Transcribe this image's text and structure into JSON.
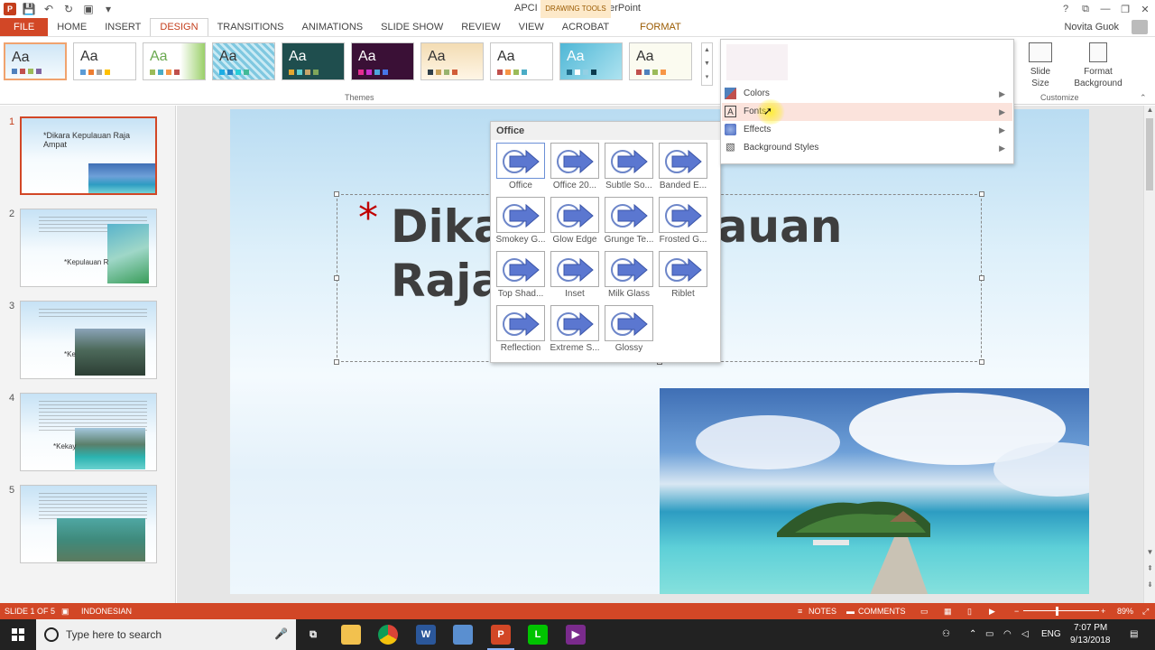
{
  "window": {
    "title": "APCI Raw.pptx - PowerPoint",
    "contextual_tab_group": "DRAWING TOOLS",
    "controls": [
      "?",
      "⧉",
      "—",
      "❐",
      "✕"
    ]
  },
  "quick_access": {
    "icons": [
      "save-icon",
      "undo-icon",
      "redo-icon",
      "start-from-beginning-icon"
    ]
  },
  "tabs": [
    {
      "label": "FILE"
    },
    {
      "label": "HOME"
    },
    {
      "label": "INSERT"
    },
    {
      "label": "DESIGN"
    },
    {
      "label": "TRANSITIONS"
    },
    {
      "label": "ANIMATIONS"
    },
    {
      "label": "SLIDE SHOW"
    },
    {
      "label": "REVIEW"
    },
    {
      "label": "VIEW"
    },
    {
      "label": "ACROBAT"
    },
    {
      "label": "FORMAT"
    }
  ],
  "user": {
    "name": "Novita Guok"
  },
  "ribbon": {
    "themes_group_label": "Themes",
    "customize_group_label": "Customize",
    "theme_sample_text": "Aa",
    "slide_size": {
      "line1": "Slide",
      "line2": "Size"
    },
    "format_background": {
      "line1": "Format",
      "line2": "Background"
    }
  },
  "variants_menu": {
    "items": [
      {
        "label": "Colors",
        "icon": "colors-icon"
      },
      {
        "label": "Fonts",
        "icon": "fonts-icon"
      },
      {
        "label": "Effects",
        "icon": "effects-icon"
      },
      {
        "label": "Background Styles",
        "icon": "background-styles-icon"
      }
    ],
    "highlighted": "Fonts"
  },
  "effects_gallery": {
    "header": "Office",
    "items": [
      {
        "label": "Office"
      },
      {
        "label": "Office 20..."
      },
      {
        "label": "Subtle So..."
      },
      {
        "label": "Banded E..."
      },
      {
        "label": "Smokey G..."
      },
      {
        "label": "Glow Edge"
      },
      {
        "label": "Grunge Te..."
      },
      {
        "label": "Frosted G..."
      },
      {
        "label": "Top Shad..."
      },
      {
        "label": "Inset"
      },
      {
        "label": "Milk Glass"
      },
      {
        "label": "Riblet"
      },
      {
        "label": "Reflection"
      },
      {
        "label": "Extreme S..."
      },
      {
        "label": "Glossy"
      }
    ]
  },
  "slides": [
    {
      "number": "1",
      "title": "*Dikara Kepulauan Raja Ampat"
    },
    {
      "number": "2",
      "label": "*Kepulauan R"
    },
    {
      "number": "3",
      "label": "*Ke"
    },
    {
      "number": "4",
      "label": "*Kekay"
    },
    {
      "number": "5",
      "label": ""
    }
  ],
  "slide": {
    "asterisk": "*",
    "title": "Dikara Kepulauan Raja Ampat"
  },
  "status_bar": {
    "slide_info": "SLIDE 1 OF 5",
    "language": "INDONESIAN",
    "notes": "NOTES",
    "comments": "COMMENTS",
    "zoom": "89%"
  },
  "taskbar": {
    "search_placeholder": "Type here to search",
    "apps": [
      "task-view-icon",
      "file-explorer-icon",
      "chrome-icon",
      "word-icon",
      "app-icon",
      "powerpoint-icon",
      "line-icon",
      "video-app-icon"
    ],
    "language": "ENG",
    "time": "7:07 PM",
    "date": "9/13/2018"
  },
  "colors": {
    "accent": "#d24726",
    "accent_dark": "#c43e1c",
    "taskbar": "#222222",
    "menu_highlight": "#fbe3dc"
  }
}
